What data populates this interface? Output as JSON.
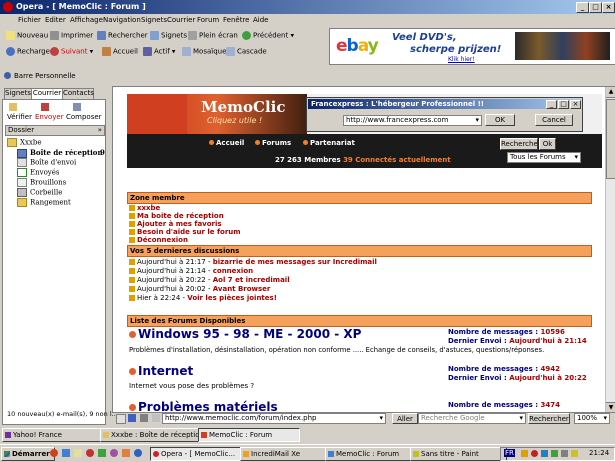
{
  "window": {
    "title": "Opera - [ MemoClic : Forum ]"
  },
  "menu": [
    "Fichier",
    "Editer",
    "Affichage",
    "Navigation",
    "Signets",
    "Courrier",
    "Forum",
    "Fenêtre",
    "Aide"
  ],
  "toolbar": {
    "row1": [
      "Nouveau",
      "Imprimer",
      "Rechercher",
      "Signets",
      "Plein écran",
      "Précédent"
    ],
    "row2": [
      "Recharger",
      "Suivant",
      "Accueil",
      "Actif",
      "Mosaïque",
      "Cascade"
    ]
  },
  "ad": {
    "brand": "ebay",
    "line1": "Veel DVD's,",
    "line2": "scherpe prijzen!",
    "link": "Klik hier!"
  },
  "personal_bar": "Barre Personnelle",
  "left_panel": {
    "tabs": [
      "Signets",
      "Courrier",
      "Contacts"
    ],
    "actions": [
      "Vérifier",
      "Envoyer",
      "Composer"
    ],
    "folder_header": "Dossier",
    "account": "Xxxbe",
    "folders": [
      {
        "label": "Boîte de réception",
        "count": "9"
      },
      {
        "label": "Boîte d'envoi",
        "count": ""
      },
      {
        "label": "Envoyés",
        "count": ""
      },
      {
        "label": "Brouillons",
        "count": ""
      },
      {
        "label": "Corbeille",
        "count": ""
      },
      {
        "label": "Rangement",
        "count": ""
      }
    ],
    "status": "10 nouveau(x) e-mail(s), 9 non l..."
  },
  "site": {
    "logo": "MemoClic",
    "tagline": "Cliquez utile !",
    "nav": [
      "Accueil",
      "Forums",
      "Partenariat"
    ],
    "members_count": "27 263 Membres",
    "connected": "39 Connectés actuellement",
    "search_button": "Recherche",
    "ok_button": "Ok",
    "forum_select": "Tous les Forums",
    "zone_title": "Zone membre",
    "zone_items": [
      "xxxbe",
      "Ma boite de réception",
      "Ajouter à mes favoris",
      "Besoin d'aide sur le forum",
      "Déconnexion"
    ],
    "recent_title": "Vos 5 dernieres discussions",
    "recent": [
      {
        "when": "Aujourd'hui à 21:17",
        "topic": "bizarrie de mes messages sur Incredimail"
      },
      {
        "when": "Aujourd'hui à 21:14",
        "topic": "connexion"
      },
      {
        "when": "Aujourd'hui à 20:22",
        "topic": "Aol 7 et incredimail"
      },
      {
        "when": "Aujourd'hui à 20:02",
        "topic": "Avant Browser"
      },
      {
        "when": "Hier à 22:24",
        "topic": "Voir les pièces jointes!"
      }
    ],
    "forums_title": "Liste des Forums Disponibles",
    "forums": [
      {
        "name": "Windows 95 - 98 - ME - 2000 - XP",
        "desc": "Problèmes d'installation, désinstallation, opération non conforme ..... Echange de conseils, d'astuces, questions/réponses.",
        "messages_label": "Nombre de messages :",
        "messages": "10596",
        "last_label": "Dernier Envoi :",
        "last": "Aujourd'hui à 21:14"
      },
      {
        "name": "Internet",
        "desc": "Internet vous pose des problèmes ?",
        "messages_label": "Nombre de messages :",
        "messages": "4942",
        "last_label": "Dernier Envoi :",
        "last": "Aujourd'hui à 20:22"
      },
      {
        "name": "Problèmes matériels",
        "desc": "",
        "messages_label": "Nombre de messages :",
        "messages": "3474",
        "last_label": "",
        "last": ""
      }
    ]
  },
  "dialog": {
    "title": "Francexpress : L'hébergeur Professionnel !!",
    "url": "http://www.francexpress.com",
    "ok": "OK",
    "cancel": "Cancel"
  },
  "address_bar": {
    "url": "http://www.memoclic.com/forum/index.php",
    "go": "Aller",
    "search_placeholder": "Recherche Google",
    "search_button": "Rechercher",
    "zoom": "100%"
  },
  "window_tabs": [
    "Yahoo! France",
    "Xxxbe : Boîte de réception",
    "MemoClic : Forum"
  ],
  "taskbar": {
    "start": "Démarrer",
    "tasks": [
      "Opera - [ MemoClic...",
      "IncrediMail Xe",
      "MemoClic : Forum",
      "Sans titre - Paint"
    ],
    "lang": "FR",
    "clock": "21:24"
  }
}
